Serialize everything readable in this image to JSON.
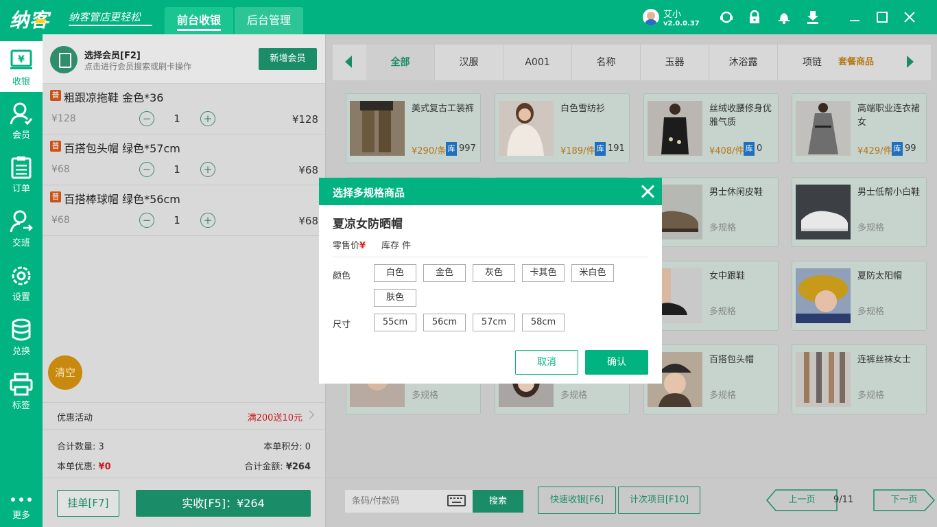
{
  "app": {
    "logo": "纳客",
    "slogan": "纳客管店更轻松",
    "tabs": [
      "前台收银",
      "后台管理"
    ],
    "username": "艾小",
    "version": "v2.0.0.37"
  },
  "nav": [
    {
      "label": "收银",
      "icon": "cashier-icon"
    },
    {
      "label": "会员",
      "icon": "member-icon"
    },
    {
      "label": "订单",
      "icon": "order-icon"
    },
    {
      "label": "交班",
      "icon": "shift-icon"
    },
    {
      "label": "设置",
      "icon": "settings-icon"
    },
    {
      "label": "兑换",
      "icon": "exchange-icon"
    },
    {
      "label": "标签",
      "icon": "print-icon"
    },
    {
      "label": "更多",
      "icon": "more-icon"
    }
  ],
  "member": {
    "title": "选择会员[F2]",
    "subtitle": "点击进行会员搜索或刷卡操作",
    "new_button": "新增会员"
  },
  "cart": [
    {
      "badge": "普",
      "name": "粗跟凉拖鞋 金色*36",
      "price": "¥128",
      "qty": "1",
      "total": "¥128"
    },
    {
      "badge": "普",
      "name": "百搭包头帽 绿色*57cm",
      "price": "¥68",
      "qty": "1",
      "total": "¥68"
    },
    {
      "badge": "普",
      "name": "百搭棒球帽 绿色*56cm",
      "price": "¥68",
      "qty": "1",
      "total": "¥68"
    }
  ],
  "qty_controls": {
    "minus": "−",
    "plus": "+"
  },
  "clear_label": "清空",
  "promo": {
    "label": "优惠活动",
    "value": "满200送10元"
  },
  "summary": {
    "count_label": "合计数量:",
    "count_value": "3",
    "points_label": "本单积分:",
    "points_value": "0",
    "discount_label": "本单优惠:",
    "discount_value": "¥0",
    "total_label": "合计金额:",
    "total_value": "¥264"
  },
  "actions": {
    "hang": "挂单[F7]",
    "pay": "实收[F5]：¥264"
  },
  "categories": [
    "全部",
    "汉服",
    "A001",
    "名称",
    "玉器",
    "沐浴露",
    "项链"
  ],
  "category_extra": "套餐商品",
  "products": [
    {
      "name": "美式复古工装裤",
      "price": "¥290/条",
      "stock_badge": "库",
      "stock": "997"
    },
    {
      "name": "白色雪纺衫",
      "price": "¥189/件",
      "stock_badge": "库",
      "stock": "191"
    },
    {
      "name": "丝绒收腰修身优雅气质",
      "price": "¥408/件",
      "stock_badge": "库",
      "stock": "0"
    },
    {
      "name": "高端职业连衣裙女",
      "price": "¥429/件",
      "stock_badge": "库",
      "stock": "99"
    },
    {
      "name": "男士休闲皮鞋",
      "multi": "多规格"
    },
    {
      "name": "男士低帮小白鞋",
      "multi": "多规格"
    },
    {
      "name": "女中跟鞋",
      "multi": "多规格"
    },
    {
      "name": "夏防太阳帽",
      "multi": "多规格"
    },
    {
      "multi": "多规格"
    },
    {
      "multi": "多规格"
    },
    {
      "name": "百搭包头帽",
      "multi": "多规格"
    },
    {
      "name": "连裤丝袜女士",
      "multi": "多规格"
    }
  ],
  "bottom": {
    "barcode_placeholder": "条码/付款码",
    "search": "搜索",
    "quick_pay": "快速收银[F6]",
    "count_items": "计次项目[F10]",
    "prev": "上一页",
    "page": "9/11",
    "next": "下一页"
  },
  "modal": {
    "title": "选择多规格商品",
    "product": "夏凉女防晒帽",
    "price_label": "零售价",
    "yen": "¥",
    "stock_label": "库存 件",
    "color_label": "颜色",
    "colors": [
      "白色",
      "金色",
      "灰色",
      "卡其色",
      "米白色",
      "肤色"
    ],
    "size_label": "尺寸",
    "sizes": [
      "55cm",
      "56cm",
      "57cm",
      "58cm"
    ],
    "cancel": "取消",
    "confirm": "确认"
  }
}
